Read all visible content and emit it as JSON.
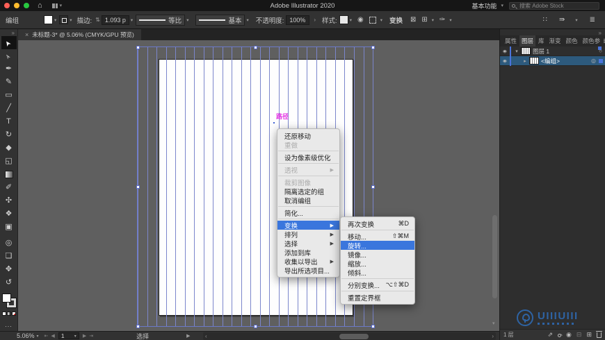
{
  "menubar": {
    "title": "Adobe Illustrator 2020",
    "home_icon": "⌂",
    "workspace_label": "基本功能",
    "search_placeholder": "搜索 Adobe Stock"
  },
  "control_bar": {
    "context_label": "编组",
    "stroke_label": "描边:",
    "stroke_value": "1.093 p",
    "profile_label": "等比",
    "brush_label": "基本",
    "opacity_label": "不透明度:",
    "opacity_value": "100%",
    "style_label": "样式:",
    "transform_button": "变换",
    "icons": {
      "recolor": "◉",
      "free_transform": "⊠",
      "shape_mode": "⊞",
      "graphic_style": "✑",
      "workspace_grid": "∷",
      "arrange_docs": "⇛",
      "app_menu": "≣"
    }
  },
  "document_tab": {
    "close": "×",
    "title": "未标题-3* @ 5.06% (CMYK/GPU 预览)"
  },
  "toolbar": {
    "collapse": "»",
    "tools": [
      {
        "id": "selection-tool",
        "glyph": "➤",
        "cls": "arrow",
        "active": true
      },
      {
        "id": "direct-selection-tool",
        "glyph": "➢",
        "cls": "arrow"
      },
      {
        "id": "pen-tool",
        "glyph": "✒"
      },
      {
        "id": "paintbrush-tool",
        "glyph": "✎"
      },
      {
        "id": "rectangle-tool",
        "glyph": "▭"
      },
      {
        "id": "line-segment-tool",
        "glyph": "╱"
      },
      {
        "id": "type-tool",
        "glyph": "T"
      },
      {
        "id": "rotate-tool",
        "glyph": "↻"
      },
      {
        "id": "eraser-tool",
        "glyph": "◆"
      },
      {
        "id": "shape-builder-tool",
        "glyph": "◱"
      },
      {
        "id": "gradient-tool",
        "glyph": "",
        "cls": "grad"
      },
      {
        "id": "eyedropper-tool",
        "glyph": "✐"
      },
      {
        "id": "blend-tool",
        "glyph": "✣"
      },
      {
        "id": "symbol-sprayer-tool",
        "glyph": "❖"
      },
      {
        "id": "artboard-tool",
        "glyph": "▣"
      }
    ],
    "tools_lower": [
      {
        "id": "zoom-tool",
        "glyph": "◎"
      },
      {
        "id": "slice-tool",
        "glyph": "❏"
      },
      {
        "id": "hand-tool",
        "glyph": "✥"
      },
      {
        "id": "rotate-view-tool",
        "glyph": "↺"
      }
    ],
    "more_dots": "..."
  },
  "canvas": {
    "path_label": "路径",
    "line_count": 26
  },
  "context_menu": {
    "items": [
      {
        "id": "undo-move",
        "label": "还原移动"
      },
      {
        "id": "redo",
        "label": "重做",
        "disabled": true
      },
      {
        "type": "sep"
      },
      {
        "id": "pixel-perfect",
        "label": "设为像素级优化"
      },
      {
        "type": "sep"
      },
      {
        "id": "perspective",
        "label": "透视",
        "disabled": true,
        "submenu": true
      },
      {
        "type": "sep"
      },
      {
        "id": "crop-image",
        "label": "裁剪图像",
        "disabled": true
      },
      {
        "id": "isolate-group",
        "label": "隔离选定的组"
      },
      {
        "id": "ungroup",
        "label": "取消编组"
      },
      {
        "type": "sep"
      },
      {
        "id": "simplify",
        "label": "简化..."
      },
      {
        "type": "sep"
      },
      {
        "id": "transform",
        "label": "变换",
        "submenu": true,
        "highlighted": true
      },
      {
        "id": "arrange",
        "label": "排列",
        "submenu": true
      },
      {
        "id": "select",
        "label": "选择",
        "submenu": true
      },
      {
        "id": "add-to-library",
        "label": "添加到库"
      },
      {
        "id": "collect-for-export",
        "label": "收集以导出",
        "submenu": true
      },
      {
        "id": "export-selection",
        "label": "导出所选项目..."
      }
    ]
  },
  "transform_submenu": {
    "items": [
      {
        "id": "transform-again",
        "label": "再次变换",
        "shortcut": "⌘D"
      },
      {
        "type": "sep"
      },
      {
        "id": "move",
        "label": "移动...",
        "shortcut": "⇧⌘M"
      },
      {
        "id": "rotate",
        "label": "旋转...",
        "highlighted": true
      },
      {
        "id": "reflect",
        "label": "镜像..."
      },
      {
        "id": "scale",
        "label": "缩放..."
      },
      {
        "id": "shear",
        "label": "倾斜..."
      },
      {
        "type": "sep"
      },
      {
        "id": "transform-each",
        "label": "分别变换...",
        "shortcut": "⌥⇧⌘D"
      },
      {
        "type": "sep"
      },
      {
        "id": "reset-bounding-box",
        "label": "重置定界框"
      }
    ]
  },
  "right_panel": {
    "collapse": "»",
    "tabs": [
      {
        "id": "properties",
        "label": "属性"
      },
      {
        "id": "layers",
        "label": "图层",
        "active": true
      },
      {
        "id": "libraries",
        "label": "库"
      },
      {
        "id": "gradient",
        "label": "渐变"
      },
      {
        "id": "color",
        "label": "颜色"
      },
      {
        "id": "color-guide",
        "label": "颜色参"
      }
    ],
    "panel_menu_icon": "≣",
    "layers": [
      {
        "id": "layer-1",
        "name": "图层 1",
        "expanded": true,
        "target": "○"
      },
      {
        "id": "group",
        "name": "<编组>",
        "selected": true,
        "target": "◎"
      }
    ],
    "bottom": {
      "count_label": "1 层"
    }
  },
  "status_bar": {
    "zoom": "5.06%",
    "artboard_value": "1",
    "tool_label": "选择"
  },
  "watermark": {
    "text": "UIIIUIII"
  }
}
